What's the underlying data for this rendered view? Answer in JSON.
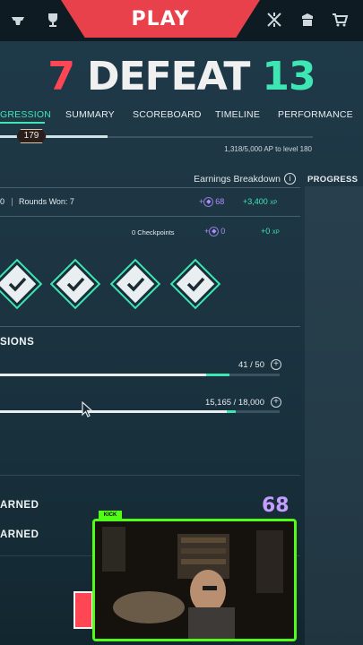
{
  "topbar": {
    "play_label": "PLAY",
    "icons": [
      "agent-icon",
      "trophy-icon",
      "crossed-swords-icon",
      "collection-icon",
      "store-icon"
    ]
  },
  "score": {
    "left": "7",
    "result": "DEFEAT",
    "right": "13"
  },
  "tabs": [
    "GRESSION",
    "SUMMARY",
    "SCOREBOARD",
    "TIMELINE",
    "PERFORMANCE"
  ],
  "level": {
    "badge": "179",
    "progress_text": "1,318/5,000 AP to level 180",
    "progress_fraction": 0.2636
  },
  "earnings": {
    "header": "Earnings Breakdown",
    "progress_tab": "PROGRESS",
    "rounds_prefix": "0",
    "rounds_won": "Rounds Won: 7",
    "rounds_kp": "68",
    "rounds_xp": "+3,400",
    "checkpoints": "0 Checkpoints",
    "checkpoints_kp": "0",
    "checkpoints_xp": "+0",
    "xp_unit": "XP"
  },
  "missions": {
    "title": "SIONS",
    "m1_value": "41 / 50",
    "m1_fraction": 0.82,
    "m2_value": "15,165 / 18,000",
    "m2_fraction": 0.8425
  },
  "bottom": {
    "earned1": "ARNED",
    "earned2": "ARNED",
    "kp_total": "68"
  },
  "stream": {
    "tag": "KICK"
  },
  "colors": {
    "accent": "#3ee6b4",
    "defeat": "#ff4655",
    "kp": "#c79cff",
    "kick": "#53fc18"
  }
}
